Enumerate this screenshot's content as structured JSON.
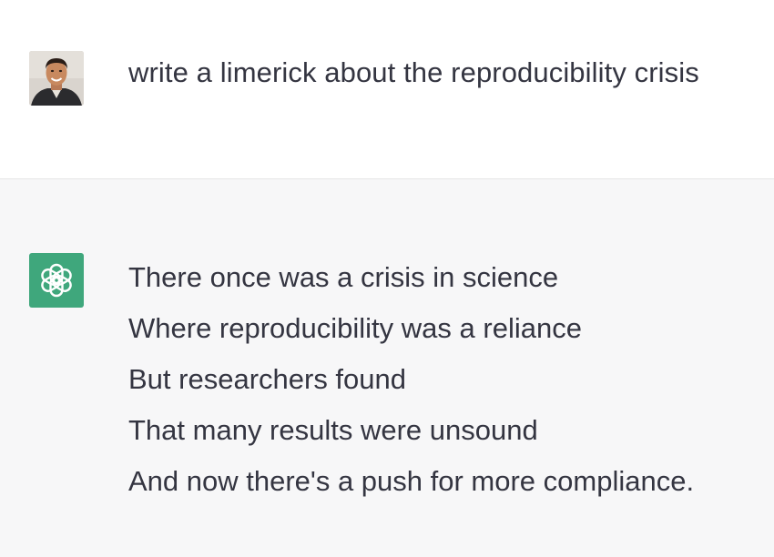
{
  "conversation": {
    "user_message": {
      "avatar_icon": "user-photo-avatar",
      "text": "write a limerick about the reproducibility crisis"
    },
    "assistant_message": {
      "avatar_icon": "openai-logo-icon",
      "avatar_color": "#3fa77c",
      "lines": [
        "There once was a crisis in science",
        "Where reproducibility was a reliance",
        "But researchers found",
        "That many results were unsound",
        "And now there's a push for more compliance."
      ]
    }
  },
  "colors": {
    "text": "#343541",
    "assistant_background": "#f7f7f8",
    "user_background": "#ffffff",
    "divider": "#e5e5e6"
  }
}
